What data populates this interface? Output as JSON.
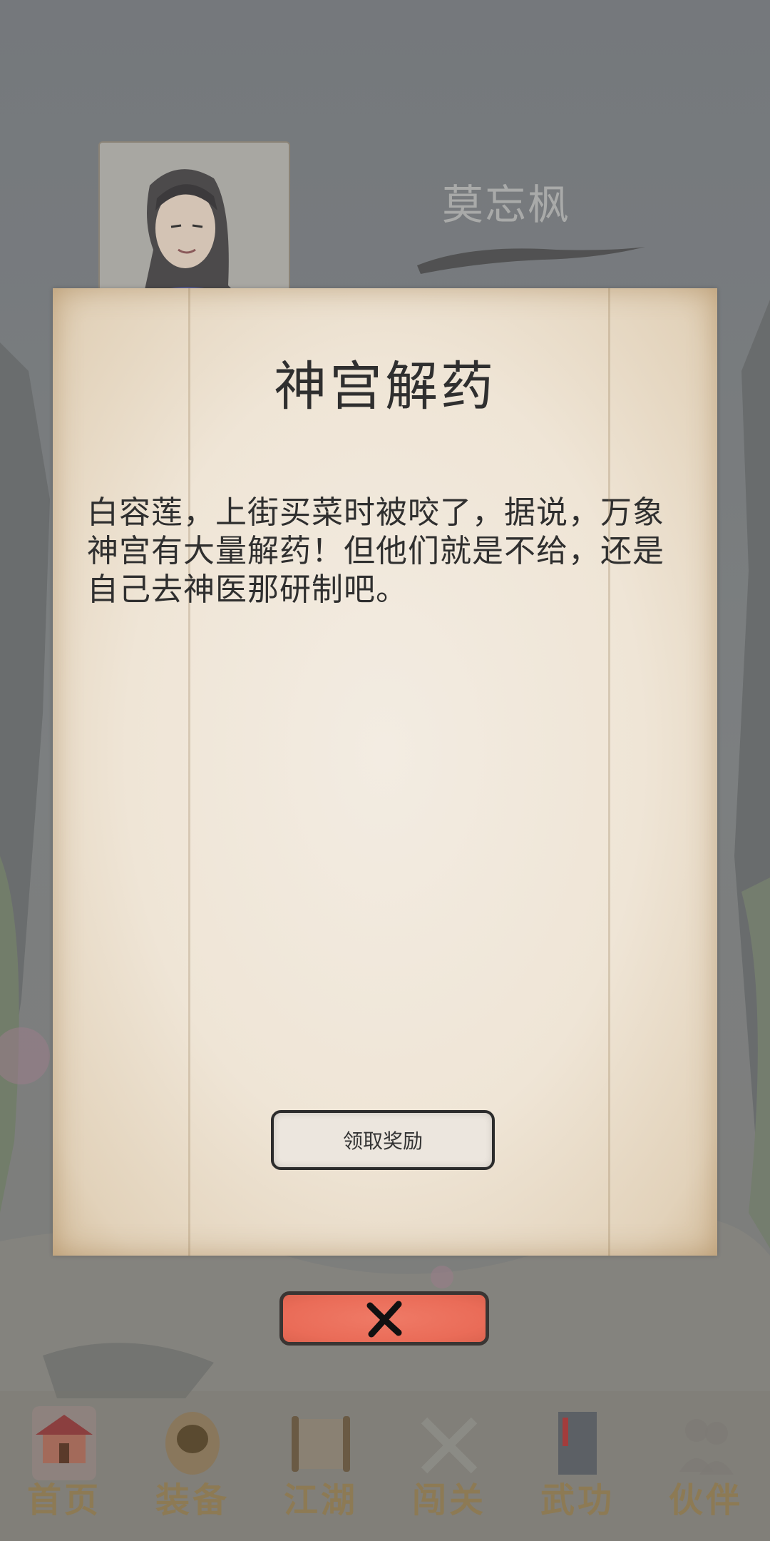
{
  "hero": {
    "name": "莫忘枫"
  },
  "dialog": {
    "title": "神宫解药",
    "body": "白容莲，上街买菜时被咬了，据说，万象神宫有大量解药！但他们就是不给，还是自己去神医那研制吧。",
    "reward_button": "领取奖励"
  },
  "close_button": {
    "icon": "close-x-icon"
  },
  "tabbar": {
    "tabs": [
      {
        "label": "首页",
        "icon": "home-pavilion-icon",
        "active": true
      },
      {
        "label": "装备",
        "icon": "armor-icon"
      },
      {
        "label": "江湖",
        "icon": "scroll-map-icon"
      },
      {
        "label": "闯关",
        "icon": "crossed-swords-icon"
      },
      {
        "label": "武功",
        "icon": "martial-book-icon"
      },
      {
        "label": "伙伴",
        "icon": "companions-icon"
      }
    ]
  },
  "colors": {
    "close_button": "#ea6c58",
    "paper": "#efe5d6",
    "tab_label": "#8d7a54",
    "text": "#2f2f2f"
  }
}
